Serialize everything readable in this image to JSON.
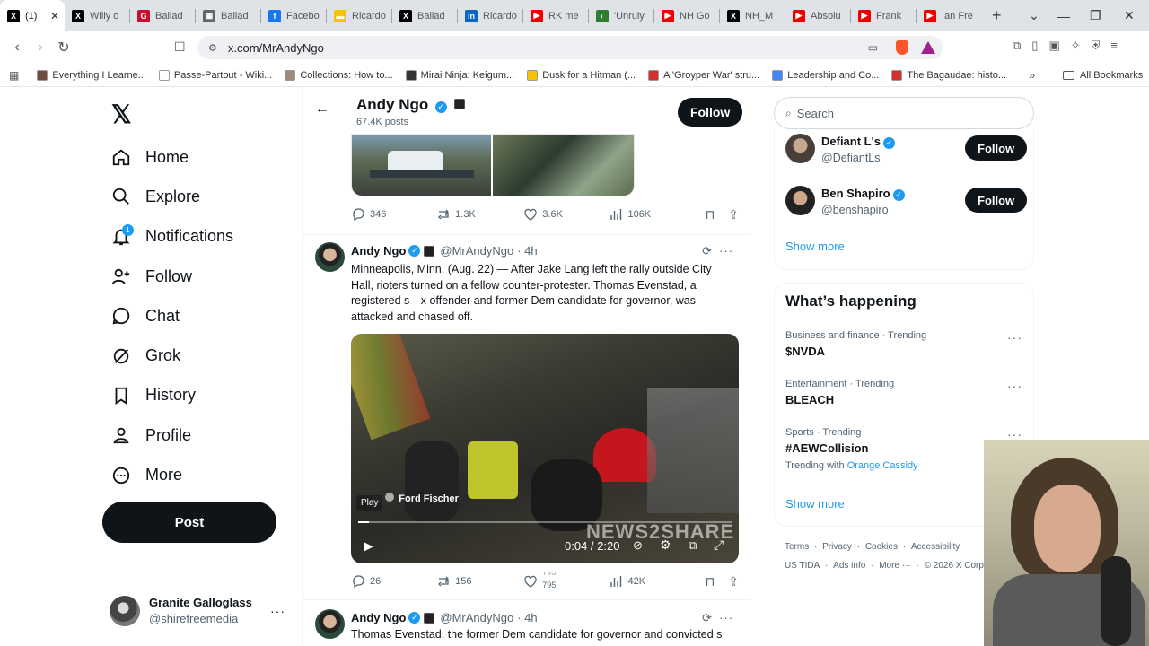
{
  "browser": {
    "tabs": [
      {
        "label": "(1)",
        "color": "#000",
        "glyph": "X"
      },
      {
        "label": "Willy o",
        "color": "#000",
        "glyph": "X"
      },
      {
        "label": "Ballad",
        "color": "#c8102e",
        "glyph": "G"
      },
      {
        "label": "Ballad",
        "color": "#666",
        "glyph": "▦"
      },
      {
        "label": "Facebo",
        "color": "#1877f2",
        "glyph": "f"
      },
      {
        "label": "Ricardo",
        "color": "#f5c400",
        "glyph": "▬"
      },
      {
        "label": "Ballad",
        "color": "#000",
        "glyph": "X"
      },
      {
        "label": "Ricardo",
        "color": "#0a66c2",
        "glyph": "in"
      },
      {
        "label": "RK me",
        "color": "#e00",
        "glyph": "▶"
      },
      {
        "label": "'Unruly",
        "color": "#2e7d32",
        "glyph": "◐"
      },
      {
        "label": "NH Go",
        "color": "#e00",
        "glyph": "▶"
      },
      {
        "label": "NH_M",
        "color": "#000",
        "glyph": "X"
      },
      {
        "label": "Absolu",
        "color": "#e00",
        "glyph": "▶"
      },
      {
        "label": "Frank",
        "color": "#e00",
        "glyph": "▶"
      },
      {
        "label": "Ian Fre",
        "color": "#e00",
        "glyph": "▶"
      }
    ],
    "url": "x.com/MrAndyNgo",
    "bookmarks": [
      {
        "label": "Everything I Learne...",
        "color": "#6d4c41"
      },
      {
        "label": "Passe-Partout - Wiki...",
        "color": "#fff"
      },
      {
        "label": "Collections: How to...",
        "color": "#a1887f"
      },
      {
        "label": "Mirai Ninja: Keigum...",
        "color": "#333"
      },
      {
        "label": "Dusk for a Hitman (...",
        "color": "#f5c400"
      },
      {
        "label": "A 'Groyper War' stru...",
        "color": "#d32f2f"
      },
      {
        "label": "Leadership and Co...",
        "color": "#4285f4"
      },
      {
        "label": "The Bagaudae: histo...",
        "color": "#d32f2f"
      }
    ],
    "all_bookmarks": "All Bookmarks"
  },
  "nav": {
    "items": [
      "Home",
      "Explore",
      "Notifications",
      "Follow",
      "Chat",
      "Grok",
      "History",
      "Profile",
      "More"
    ],
    "notif_count": "1",
    "post": "Post",
    "account": {
      "name": "Granite Galloglass",
      "handle": "@shirefreemedia"
    }
  },
  "header": {
    "name": "Andy Ngo",
    "posts": "67.4K posts",
    "follow": "Follow"
  },
  "tweet0_stats": {
    "reply": "346",
    "retweet": "1.3K",
    "like": "3.6K",
    "views": "106K"
  },
  "tweet1": {
    "name": "Andy Ngo",
    "handle": "@MrAndyNgo",
    "time": "· 4h",
    "text": "Minneapolis, Minn. (Aug. 22) — After Jake Lang left the rally outside City Hall, rioters turned on a fellow counter-protester. Thomas Evenstad, a registered s—x offender and former Dem candidate for governor, was attacked and chased off.",
    "video": {
      "tooltip": "Play",
      "credit": "Ford Fischer",
      "credit_prefix": "m",
      "time": "0:04 / 2:20",
      "watermark": "NEWS2SHARE",
      "progress": 0.029
    },
    "stats": {
      "reply": "26",
      "retweet": "156",
      "like_top": "795",
      "like_bottom": "795",
      "views": "42K"
    }
  },
  "tweet2": {
    "name": "Andy Ngo",
    "handle": "@MrAndyNgo",
    "time": "· 4h",
    "text": "Thomas Evenstad, the former Dem candidate for governor and convicted s"
  },
  "right": {
    "search_placeholder": "Search",
    "who": [
      {
        "name": "Defiant L's",
        "handle": "@DefiantLs",
        "follow": "Follow"
      },
      {
        "name": "Ben Shapiro",
        "handle": "@benshapiro",
        "follow": "Follow"
      }
    ],
    "show_more": "Show more",
    "happening_title": "What’s happening",
    "trends": [
      {
        "cat": "Business and finance · Trending",
        "title": "$NVDA",
        "sub": ""
      },
      {
        "cat": "Entertainment · Trending",
        "title": "BLEACH",
        "sub": ""
      },
      {
        "cat": "Sports · Trending",
        "title": "#AEWCollision",
        "sub_prefix": "Trending with ",
        "sub_link": "Orange Cassidy"
      }
    ],
    "show_more2": "Show more",
    "footer1": [
      "Terms",
      "Privacy",
      "Cookies",
      "Accessibility"
    ],
    "footer2": [
      "US TIDA",
      "Ads info",
      "More ···",
      "© 2026 X Corp."
    ]
  }
}
